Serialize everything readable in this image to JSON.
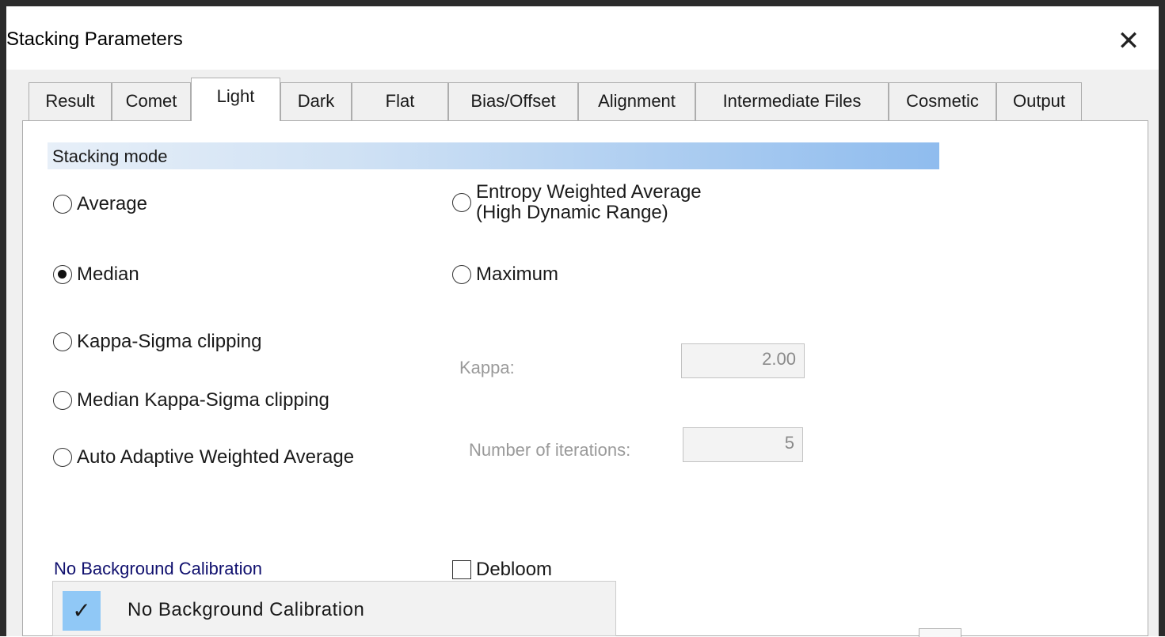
{
  "window": {
    "title": "Stacking Parameters",
    "close_glyph": "✕"
  },
  "tabs": [
    {
      "label": "Result"
    },
    {
      "label": "Comet"
    },
    {
      "label": "Light",
      "active": true
    },
    {
      "label": "Dark"
    },
    {
      "label": "Flat"
    },
    {
      "label": "Bias/Offset"
    },
    {
      "label": "Alignment"
    },
    {
      "label": "Intermediate Files"
    },
    {
      "label": "Cosmetic"
    },
    {
      "label": "Output"
    }
  ],
  "stacking_mode": {
    "header": "Stacking mode",
    "options": {
      "average": {
        "label": "Average",
        "selected": false
      },
      "entropy": {
        "label_line1": "Entropy Weighted Average",
        "label_line2": "(High Dynamic Range)",
        "selected": false
      },
      "median": {
        "label": "Median",
        "selected": true
      },
      "maximum": {
        "label": "Maximum",
        "selected": false
      },
      "kappa_sigma": {
        "label": "Kappa-Sigma clipping",
        "selected": false
      },
      "median_kappa_sigma": {
        "label": "Median Kappa-Sigma clipping",
        "selected": false
      },
      "auto_adaptive": {
        "label": "Auto Adaptive Weighted Average",
        "selected": false
      }
    },
    "kappa": {
      "label": "Kappa:",
      "value": "2.00",
      "enabled": false
    },
    "iterations": {
      "label": "Number of iterations:",
      "value": "5",
      "enabled": false
    }
  },
  "background_calibration": {
    "link_label": "No Background Calibration",
    "menu_items": [
      {
        "label": "No Background Calibration",
        "checked": true,
        "check_glyph": "✓"
      }
    ]
  },
  "debloom": {
    "label": "Debloom",
    "checked": false
  },
  "colors": {
    "accent_gradient_end": "#8fbcee",
    "link": "#10106e",
    "menu_check_bg": "#90c8f6"
  }
}
